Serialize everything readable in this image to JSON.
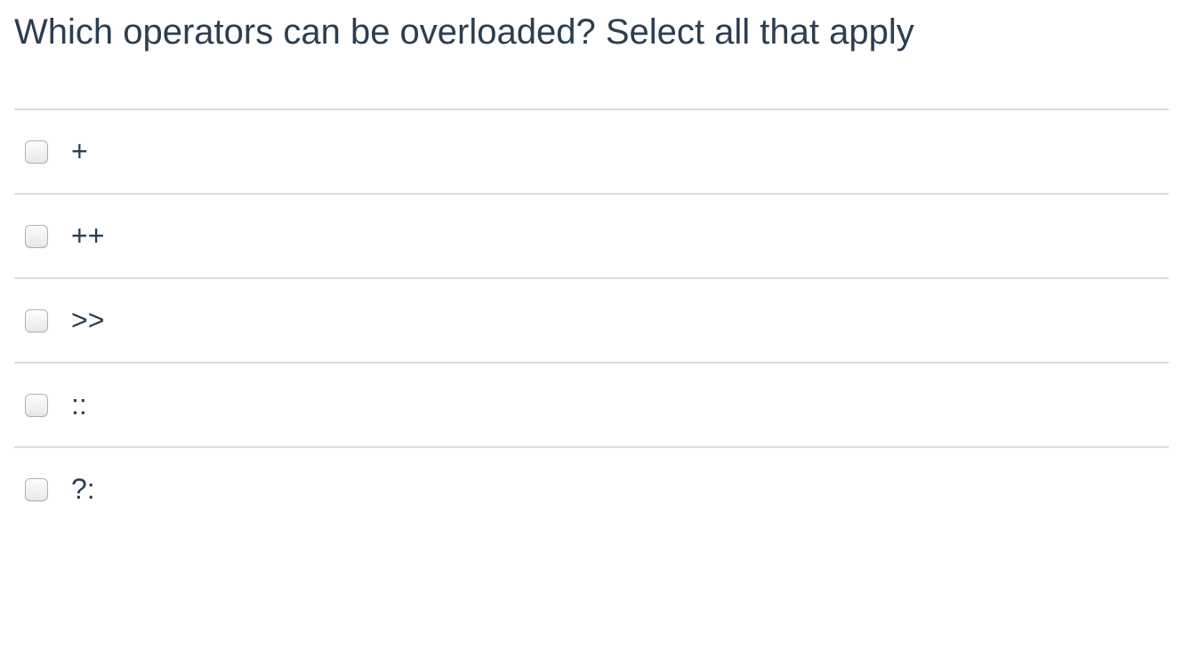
{
  "question": "Which operators can be overloaded? Select all that apply",
  "options": [
    {
      "label": "+",
      "checked": false
    },
    {
      "label": "++",
      "checked": false
    },
    {
      "label": ">>",
      "checked": false
    },
    {
      "label": "::",
      "checked": false
    },
    {
      "label": "?:",
      "checked": false
    }
  ]
}
